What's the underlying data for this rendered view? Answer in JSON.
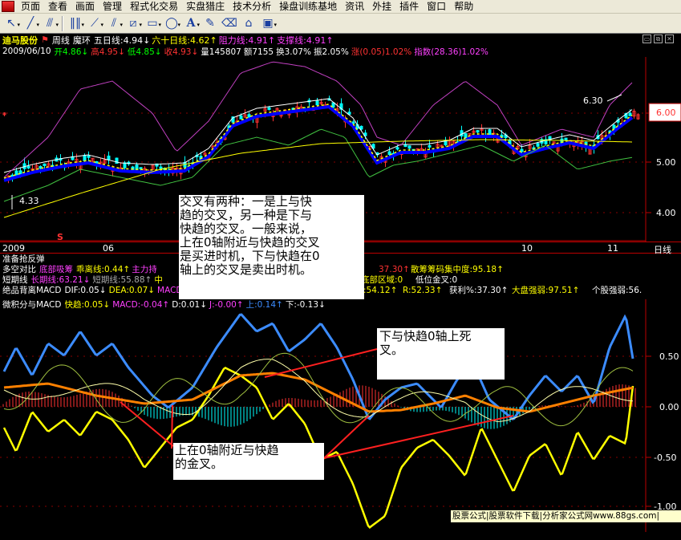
{
  "menu": [
    "页面",
    "查看",
    "画面",
    "管理",
    "程式化交易",
    "实盘猎庄",
    "技术分析",
    "操盘训练基地",
    "资讯",
    "外挂",
    "插件",
    "窗口",
    "帮助"
  ],
  "toolbar_icons": [
    "pointer-icon",
    "line-icon",
    "parallel-icon",
    "fibonacci-icon",
    "channel-icon",
    "trend-icon",
    "rectangle-icon",
    "ellipse-icon",
    "text-icon",
    "erase-icon",
    "save-icon"
  ],
  "header": {
    "stock": "迪马股份",
    "period": "周线",
    "indicator": "魔环",
    "ma5": "五日线:4.94↓",
    "ma60": "六十日线:4.62↑",
    "resist": "阻力线:4.91↑",
    "support": "支撑线:4.91↑"
  },
  "quote": {
    "date": "2009/06/10",
    "open": "开4.86↓",
    "high": "高4.95↓",
    "low": "低4.85↓",
    "close": "收4.93↓",
    "vol": "量145807",
    "amount": "额7155",
    "turn": "换3.07%",
    "amp": "振2.05%",
    "change": "涨(0.05)1.02%",
    "index": "指数(28.36)1.02%"
  },
  "price_axis": [
    "6.00",
    "5.00",
    "4.00"
  ],
  "price_labels": {
    "high": "6.30",
    "low": "4.33",
    "mark": "S"
  },
  "x_axis": {
    "left": "2009",
    "ticks": [
      "06",
      "10",
      "11"
    ],
    "period": "日线"
  },
  "ind_rows": {
    "r1": "准备抢反弹",
    "r2_a": "多空对比",
    "r2_b": "底部吸筹",
    "r2_c": "乖离线:0.44↑",
    "r2_d": "主力持",
    "r2_e": "37.30↑",
    "r2_f": "散筹筹码集中度:95.18↑",
    "r3_a": "短期线",
    "r3_b": "长期线:63.21↓",
    "r3_c": "短期线:55.88↑",
    "r3_d": "中",
    "r3_e": "底部区域:0",
    "r3_f": "低位金叉:0",
    "r4_a": "绝品背离MACD",
    "r4_b": "DIF:0.05↓",
    "r4_c": "DEA:0.07↓",
    "r4_d": "MACD",
    "r4_e": ":54.12↑",
    "r4_f": "R:52.33↑",
    "r4_g": "获利%:37.30↑",
    "r4_h": "大盘强弱:97.51↑",
    "r4_i": "个股强弱:56.",
    "r5_a": "微积分与MACD",
    "r5_b": "快趋:0.05↓",
    "r5_c": "MACD:-0.04↑",
    "r5_d": "D:0.01↓",
    "r5_e": "J:-0.00↑",
    "r5_f": "上:0.14↑",
    "r5_g": "下:-0.13↓"
  },
  "ind_axis": [
    "0.50",
    "0.00",
    "-0.50",
    "-1.00"
  ],
  "notes": {
    "n1_lines": [
      "交叉有两种：一是上与快",
      "趋的交叉，另一种是下与",
      "快趋的交叉。一般来说，",
      "上在0轴附近与快趋的交叉",
      "是买进时机，下与快趋在0",
      "轴上的交叉是卖出时机。"
    ],
    "n2_lines": [
      "下与快趋0轴上死",
      "叉。"
    ],
    "n3_lines": [
      "上在0轴附近与快趋",
      "的金叉。"
    ]
  },
  "watermark": "股票公式|股票软件下载|分析家公式网www.88gs.com|",
  "colors": {
    "up": "#ff3232",
    "down": "#00ffff",
    "blue": "#0000ff",
    "yellow": "#ffff00",
    "magenta": "#c040c0",
    "green": "#40c040",
    "orange": "#ff8000",
    "ind_blue": "#3c8cff"
  }
}
